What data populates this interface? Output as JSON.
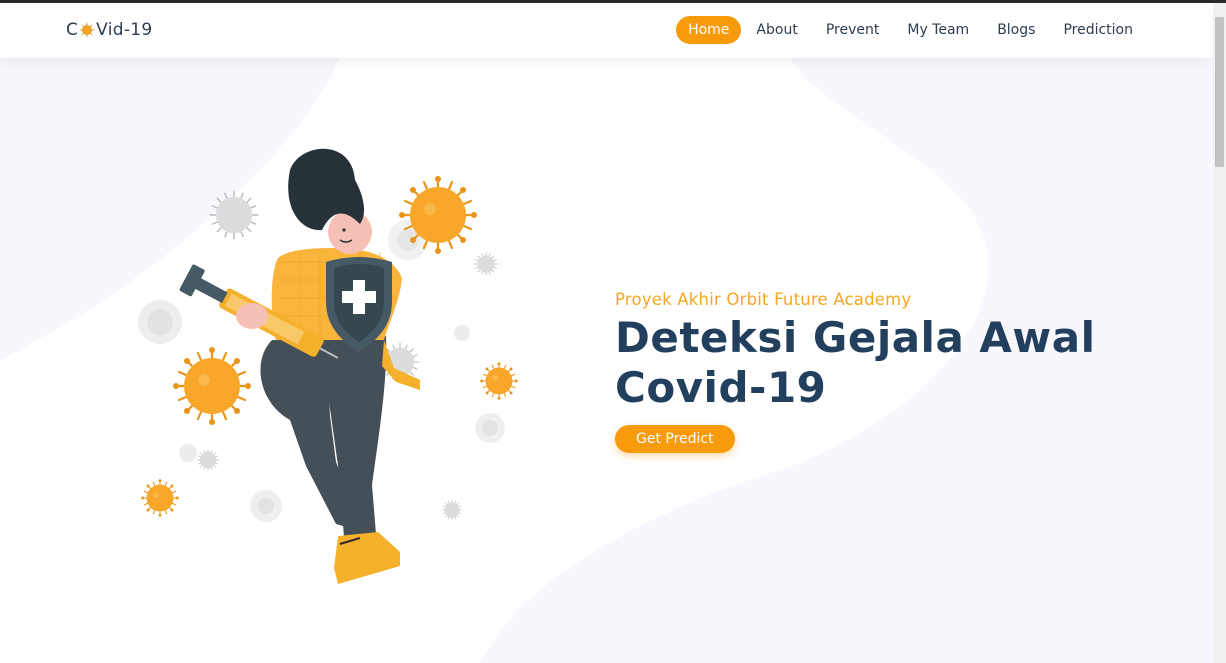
{
  "brand": {
    "prefix": "C",
    "suffix": "Vid-19",
    "logo_icon": "virus-icon"
  },
  "nav": {
    "items": [
      {
        "label": "Home",
        "active": true
      },
      {
        "label": "About",
        "active": false
      },
      {
        "label": "Prevent",
        "active": false
      },
      {
        "label": "My Team",
        "active": false
      },
      {
        "label": "Blogs",
        "active": false
      },
      {
        "label": "Prediction",
        "active": false
      }
    ]
  },
  "hero": {
    "subtitle": "Proyek Akhir Orbit Future Academy",
    "title": "Deteksi Gejala Awal Covid-19",
    "cta_label": "Get Predict"
  },
  "colors": {
    "accent": "#f79a0c",
    "title": "#22405e",
    "text": "#2c3e50",
    "background": "#f7f7fd"
  }
}
